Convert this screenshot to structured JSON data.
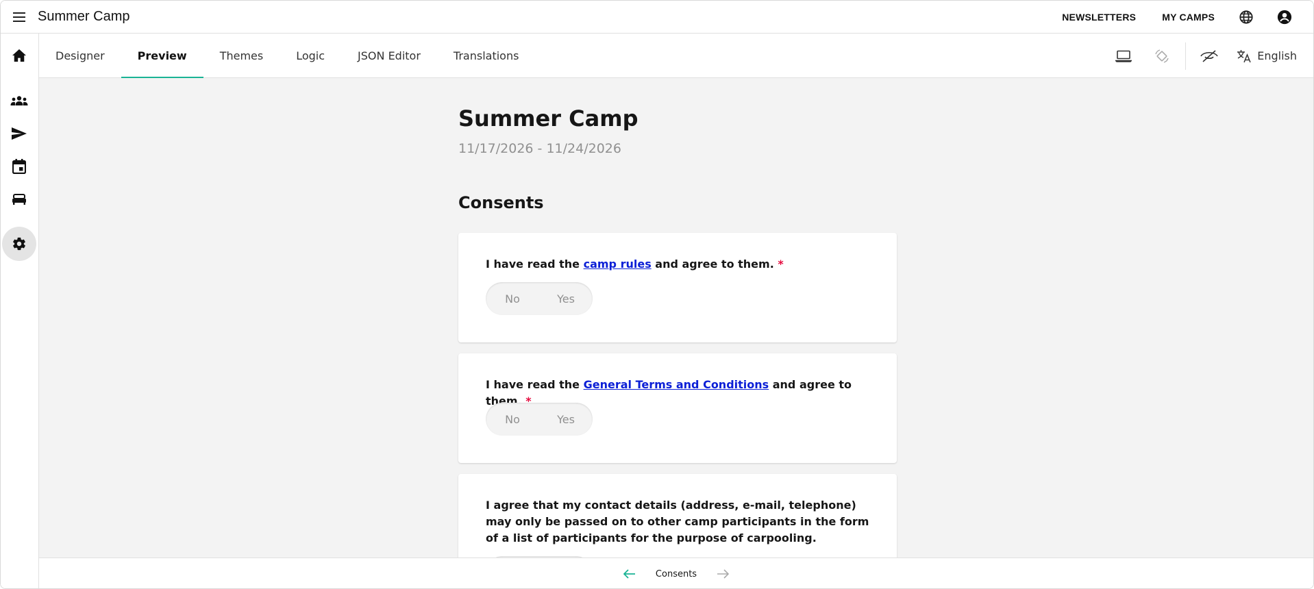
{
  "app": {
    "title": "Summer Camp"
  },
  "topnav": {
    "links": [
      "NEWSLETTERS",
      "MY CAMPS"
    ],
    "icons": [
      "globe-icon",
      "account-icon"
    ]
  },
  "sidebar": {
    "items": [
      "home-icon",
      "people-icon",
      "send-icon",
      "calendar-icon",
      "bed-icon",
      "settings-icon"
    ],
    "active": "settings-icon"
  },
  "tabs": {
    "items": [
      {
        "label": "Designer"
      },
      {
        "label": "Preview"
      },
      {
        "label": "Themes"
      },
      {
        "label": "Logic"
      },
      {
        "label": "JSON Editor"
      },
      {
        "label": "Translations"
      }
    ],
    "active": "Preview",
    "language": "English"
  },
  "survey": {
    "title": "Summer Camp",
    "dates": "11/17/2026 - 11/24/2026",
    "page_title": "Consents",
    "questions": [
      {
        "before": "I have read the ",
        "link": "camp rules",
        "after": " and agree to them.",
        "required": "*",
        "options": [
          "No",
          "Yes"
        ]
      },
      {
        "before": "I have read the ",
        "link": "General Terms and Conditions",
        "after": " and agree to them.",
        "required": "*",
        "options": [
          "No",
          "Yes"
        ]
      },
      {
        "text": "I agree that my contact details (address, e-mail, telephone) may only be passed on to other camp participants in the form of a list of participants for the purpose of carpooling."
      }
    ]
  },
  "bottomnav": {
    "label": "Consents"
  },
  "colors": {
    "accent": "#19b394",
    "required": "#e50a3e",
    "link": "#0b1fd6",
    "background": "#f3f3f3"
  }
}
